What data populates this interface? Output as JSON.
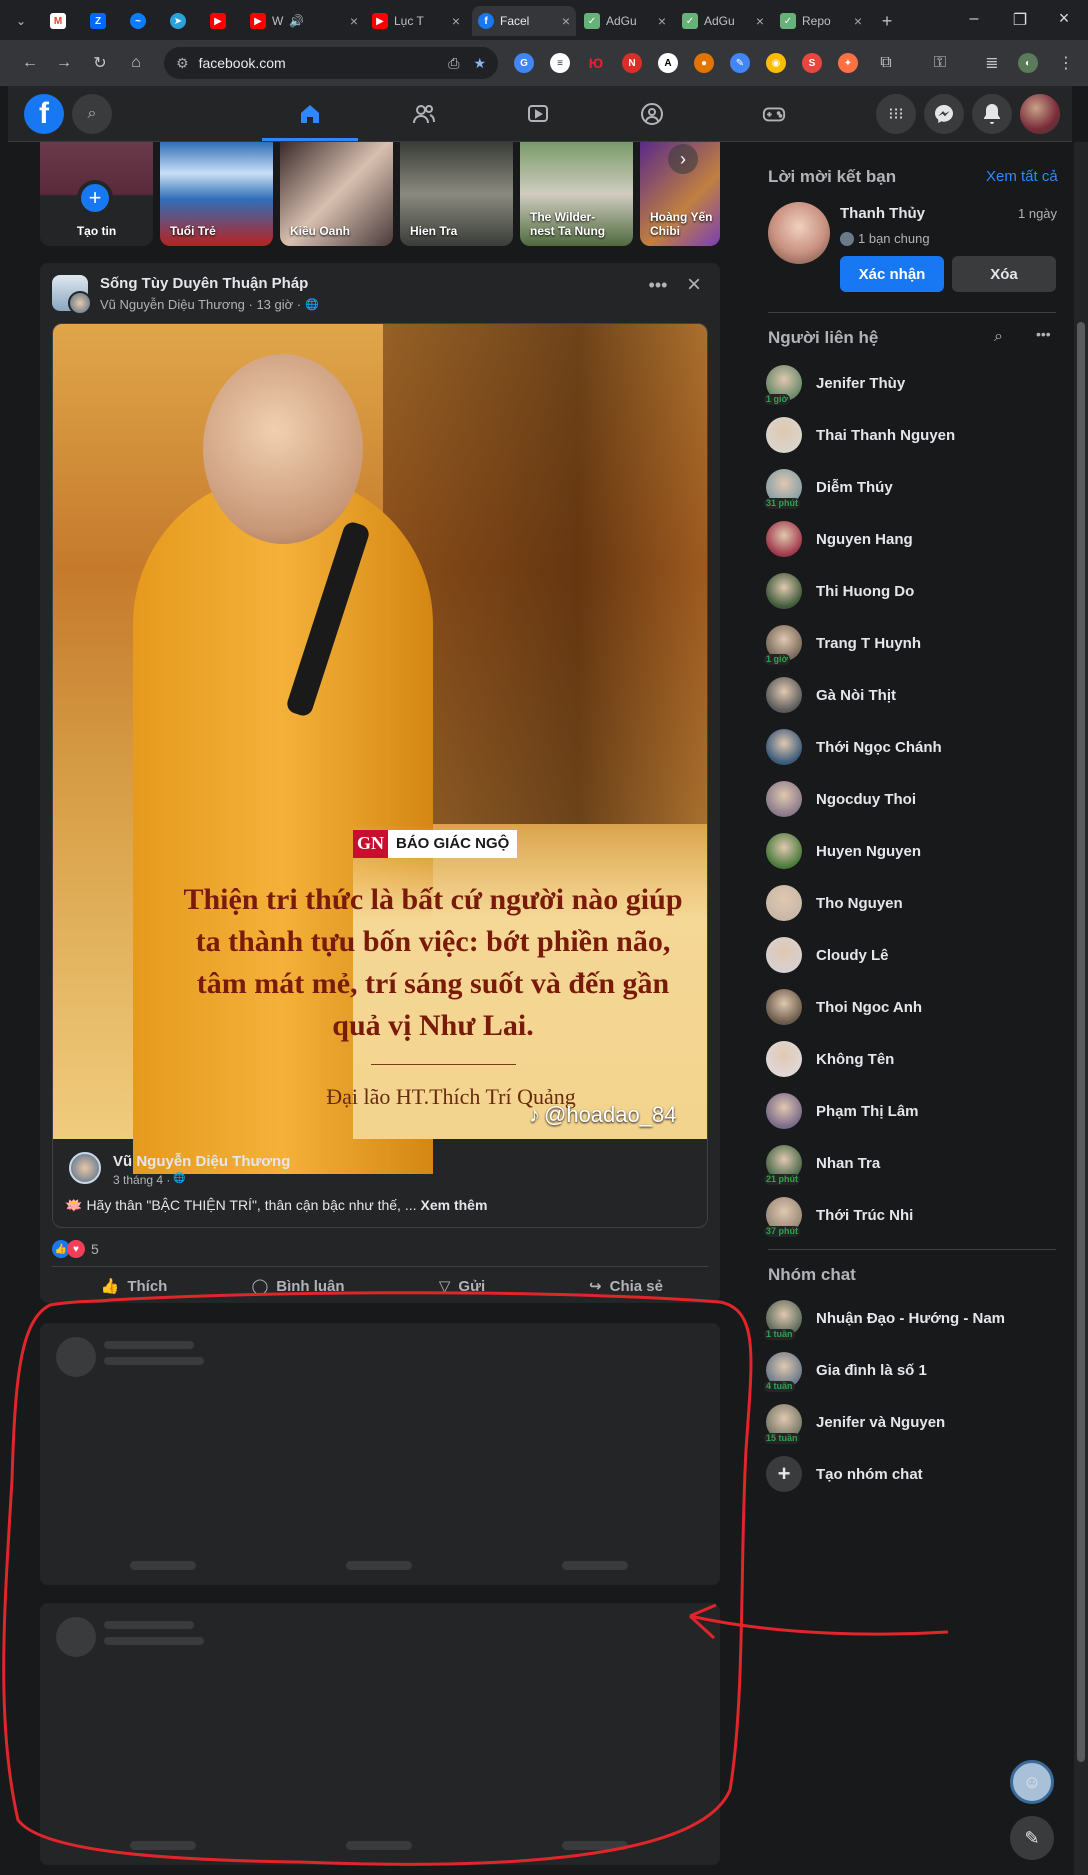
{
  "browser": {
    "tabs": [
      {
        "label": "",
        "icon": "gmail-icon",
        "color": "#ea4335"
      },
      {
        "label": "",
        "icon": "zalo-icon",
        "color": "#0068ff"
      },
      {
        "label": "",
        "icon": "messenger-icon",
        "color": "#0a7cff"
      },
      {
        "label": "",
        "icon": "telegram-icon",
        "color": "#2aa1da"
      },
      {
        "label": "",
        "icon": "youtube-icon",
        "color": "#ff0000"
      },
      {
        "label": "W",
        "icon": "youtube-icon",
        "color": "#ff0000"
      },
      {
        "label": "Lục T",
        "icon": "youtube-icon",
        "color": "#ff0000"
      },
      {
        "label": "Facel",
        "icon": "facebook-icon",
        "color": "#1877f2"
      },
      {
        "label": "AdGu",
        "icon": "adguard-icon",
        "color": "#67b279"
      },
      {
        "label": "AdGu",
        "icon": "adguard-icon",
        "color": "#67b279"
      },
      {
        "label": "Repo",
        "icon": "adguard-icon",
        "color": "#67b279"
      }
    ],
    "url": "facebook.com"
  },
  "stories": [
    {
      "label": "Tạo tin",
      "color": "#5a3a4a"
    },
    {
      "label": "Tuổi Trẻ",
      "color": "#2f6fb8"
    },
    {
      "label": "Kiều Oanh",
      "color": "#6e5a52"
    },
    {
      "label": "Hien Tra",
      "color": "#5b5d54"
    },
    {
      "label": "The Wilder-\nnest Ta Nung",
      "color": "#4e6a3e"
    },
    {
      "label": "Hoàng Yến\nChibi",
      "color": "#7a3fb5"
    }
  ],
  "post": {
    "group_name": "Sống Tùy Duyên Thuận Pháp",
    "author_line": "Vũ Nguyễn Diệu Thương · 13 giờ ·",
    "image": {
      "brand_gn": "GN",
      "brand_name": "BÁO GIÁC NGỘ",
      "quote": "Thiện tri thức là bất cứ người nào giúp ta thành tựu bốn việc: bớt phiền não, tâm mát mẻ, trí sáng suốt và đến gần quả vị Như Lai.",
      "attribution": "Đại lão HT.Thích Trí Quảng",
      "watermark": "@hoadao_84"
    },
    "shared_author": "Vũ Nguyễn Diệu Thương",
    "shared_date": "3 tháng 4 ·",
    "shared_text": "Hãy thân \"BẬC THIỆN TRÍ\", thân cận bậc như thế, ...",
    "see_more": "Xem thêm",
    "reaction_count": "5",
    "actions": {
      "like": "Thích",
      "comment": "Bình luận",
      "send": "Gửi",
      "share": "Chia sẻ"
    }
  },
  "friend_requests": {
    "title": "Lời mời kết bạn",
    "see_all": "Xem tất cả",
    "name": "Thanh Thủy",
    "time": "1 ngày",
    "mutual": "1 bạn chung",
    "confirm": "Xác nhận",
    "delete": "Xóa"
  },
  "contacts": {
    "title": "Người liên hệ",
    "list": [
      {
        "name": "Jenifer Thùy",
        "badge": "1 giờ",
        "color": "#6b8a6b"
      },
      {
        "name": "Thai Thanh Nguyen",
        "badge": "",
        "color": "#d9d4cc"
      },
      {
        "name": "Diễm Thúy",
        "badge": "31 phút",
        "color": "#8aa0a8"
      },
      {
        "name": "Nguyen Hang",
        "badge": "",
        "color": "#a0374a"
      },
      {
        "name": "Thi Huong Do",
        "badge": "",
        "color": "#3e5a3a"
      },
      {
        "name": "Trang T Huynh",
        "badge": "1 giờ",
        "color": "#7a6a5a"
      },
      {
        "name": "Gà Nòi Thịt",
        "badge": "",
        "color": "#5a5a5a"
      },
      {
        "name": "Thới Ngọc Chánh",
        "badge": "",
        "color": "#3a5a7a"
      },
      {
        "name": "Ngocduy Thoi",
        "badge": "",
        "color": "#8a7a8a"
      },
      {
        "name": "Huyen Nguyen",
        "badge": "",
        "color": "#4a7a3a"
      },
      {
        "name": "Tho Nguyen",
        "badge": "",
        "color": "#c8b8a8"
      },
      {
        "name": "Cloudy Lê",
        "badge": "",
        "color": "#d8d0d0"
      },
      {
        "name": "Thoi Ngoc Anh",
        "badge": "",
        "color": "#6a5a4a"
      },
      {
        "name": "Không Tên",
        "badge": "",
        "color": "#e0d8d8"
      },
      {
        "name": "Phạm Thị Lâm",
        "badge": "",
        "color": "#7a6a8a"
      },
      {
        "name": "Nhan Tra",
        "badge": "21 phút",
        "color": "#4a6a4a"
      },
      {
        "name": "Thới Trúc Nhi",
        "badge": "37 phút",
        "color": "#9a8a7a"
      }
    ]
  },
  "group_chats": {
    "title": "Nhóm chat",
    "list": [
      {
        "name": "Nhuận Đạo - Hướng - Nam",
        "badge": "1 tuần",
        "color": "#5a6a5a"
      },
      {
        "name": "Gia đình là số 1",
        "badge": "4 tuần",
        "color": "#6a7a8a"
      },
      {
        "name": "Jenifer và Nguyen",
        "badge": "15 tuần",
        "color": "#7a7a6a"
      }
    ],
    "create": "Tạo nhóm chat"
  },
  "colors": {
    "accent": "#1877f2",
    "annotation": "#e0262a"
  }
}
